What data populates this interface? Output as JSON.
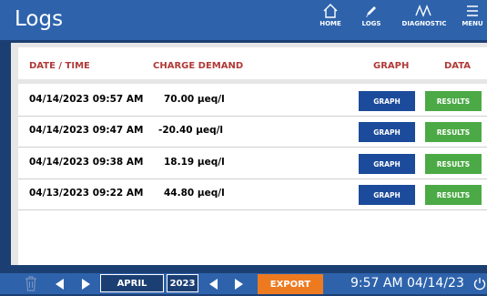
{
  "header": {
    "title": "Logs"
  },
  "nav": [
    {
      "label": "HOME",
      "icon": "home-icon"
    },
    {
      "label": "LOGS",
      "icon": "pencil-icon"
    },
    {
      "label": "DIAGNOSTIC",
      "icon": "waveform-icon"
    },
    {
      "label": "MENU",
      "icon": "hamburger-menu-icon"
    }
  ],
  "table": {
    "columns": [
      "DATE / TIME",
      "CHARGE DEMAND",
      "GRAPH",
      "DATA"
    ],
    "rows": [
      {
        "datetime": "04/14/2023 09:57 AM",
        "charge": "70.00 µeq/l",
        "graph_label": "GRAPH",
        "data_label": "RESULTS"
      },
      {
        "datetime": "04/14/2023 09:47 AM",
        "charge": "-20.40 µeq/l",
        "graph_label": "GRAPH",
        "data_label": "RESULTS"
      },
      {
        "datetime": "04/14/2023 09:38 AM",
        "charge": "18.19 µeq/l",
        "graph_label": "GRAPH",
        "data_label": "RESULTS"
      },
      {
        "datetime": "04/13/2023 09:22 AM",
        "charge": "44.80 µeq/l",
        "graph_label": "GRAPH",
        "data_label": "RESULTS"
      }
    ]
  },
  "footer": {
    "month": "APRIL",
    "year": "2023",
    "export_label": "EXPORT",
    "clock": "9:57 AM 04/14/23"
  },
  "colors": {
    "top_bar": "#2e63ac",
    "header_text": "#b03a37",
    "graph_button": "#1b4b9a",
    "results_button": "#4caa46",
    "export_button": "#ee7a20"
  }
}
